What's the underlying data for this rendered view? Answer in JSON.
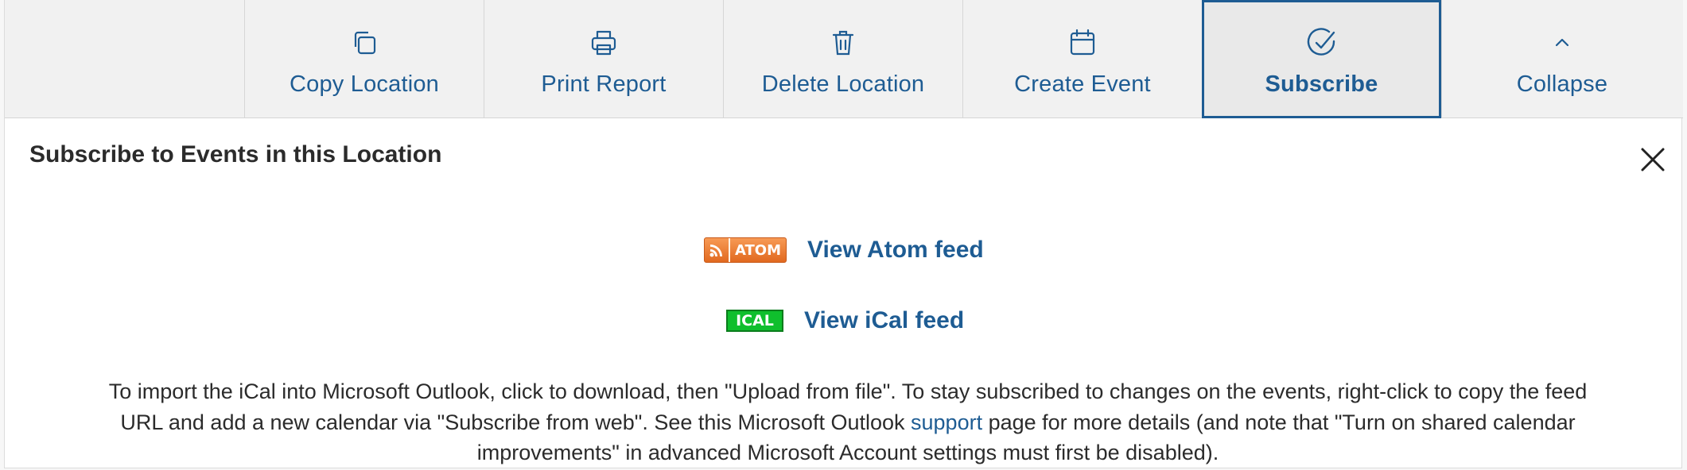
{
  "toolbar": {
    "buttons": [
      {
        "label": "Copy Location",
        "icon": "copy-icon"
      },
      {
        "label": "Print Report",
        "icon": "printer-icon"
      },
      {
        "label": "Delete Location",
        "icon": "trash-icon"
      },
      {
        "label": "Create Event",
        "icon": "calendar-icon"
      },
      {
        "label": "Subscribe",
        "icon": "check-circle-icon",
        "active": true
      },
      {
        "label": "Collapse",
        "icon": "chevron-up-icon"
      }
    ]
  },
  "panel": {
    "title": "Subscribe to Events in this Location",
    "close_icon": "close-icon",
    "atom": {
      "badge": "ATOM",
      "link": "View Atom feed"
    },
    "ical": {
      "badge": "ICAL",
      "link": "View iCal feed"
    },
    "help": {
      "before": "To import the iCal into Microsoft Outlook, click to download, then \"Upload from file\". To stay subscribed to changes on the events, right-click to copy the feed URL and add a new calendar via \"Subscribe from web\". See this Microsoft Outlook ",
      "link": "support",
      "after": " page for more details (and note that \"Turn on shared calendar improvements\" in advanced Microsoft Account settings must first be disabled)."
    }
  },
  "colors": {
    "accent": "#1e5c93",
    "atom_orange": "#e1691f",
    "ical_green": "#0fbf2d"
  }
}
